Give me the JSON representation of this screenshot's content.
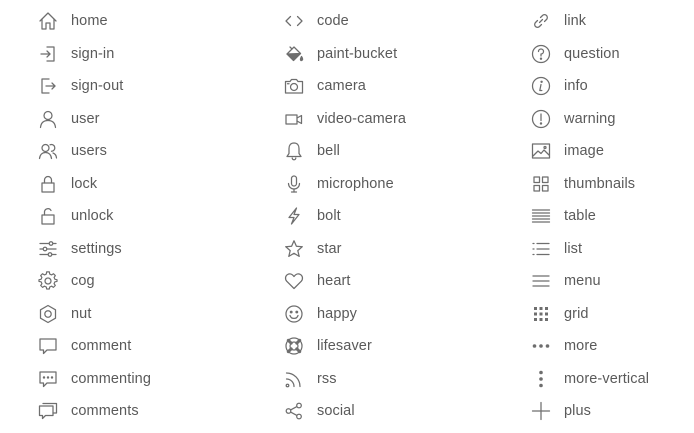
{
  "columns": [
    {
      "items": [
        {
          "icon": "home-icon",
          "label": "home"
        },
        {
          "icon": "sign-in-icon",
          "label": "sign-in"
        },
        {
          "icon": "sign-out-icon",
          "label": "sign-out"
        },
        {
          "icon": "user-icon",
          "label": "user"
        },
        {
          "icon": "users-icon",
          "label": "users"
        },
        {
          "icon": "lock-icon",
          "label": "lock"
        },
        {
          "icon": "unlock-icon",
          "label": "unlock"
        },
        {
          "icon": "settings-icon",
          "label": "settings"
        },
        {
          "icon": "cog-icon",
          "label": "cog"
        },
        {
          "icon": "nut-icon",
          "label": "nut"
        },
        {
          "icon": "comment-icon",
          "label": "comment"
        },
        {
          "icon": "commenting-icon",
          "label": "commenting"
        },
        {
          "icon": "comments-icon",
          "label": "comments"
        }
      ]
    },
    {
      "items": [
        {
          "icon": "code-icon",
          "label": "code"
        },
        {
          "icon": "paint-bucket-icon",
          "label": "paint-bucket"
        },
        {
          "icon": "camera-icon",
          "label": "camera"
        },
        {
          "icon": "video-camera-icon",
          "label": "video-camera"
        },
        {
          "icon": "bell-icon",
          "label": "bell"
        },
        {
          "icon": "microphone-icon",
          "label": "microphone"
        },
        {
          "icon": "bolt-icon",
          "label": "bolt"
        },
        {
          "icon": "star-icon",
          "label": "star"
        },
        {
          "icon": "heart-icon",
          "label": "heart"
        },
        {
          "icon": "happy-icon",
          "label": "happy"
        },
        {
          "icon": "lifesaver-icon",
          "label": "lifesaver"
        },
        {
          "icon": "rss-icon",
          "label": "rss"
        },
        {
          "icon": "social-icon",
          "label": "social"
        }
      ]
    },
    {
      "items": [
        {
          "icon": "link-icon",
          "label": "link"
        },
        {
          "icon": "question-icon",
          "label": "question"
        },
        {
          "icon": "info-icon",
          "label": "info"
        },
        {
          "icon": "warning-icon",
          "label": "warning"
        },
        {
          "icon": "image-icon",
          "label": "image"
        },
        {
          "icon": "thumbnails-icon",
          "label": "thumbnails"
        },
        {
          "icon": "table-icon",
          "label": "table"
        },
        {
          "icon": "list-icon",
          "label": "list"
        },
        {
          "icon": "menu-icon",
          "label": "menu"
        },
        {
          "icon": "grid-icon",
          "label": "grid"
        },
        {
          "icon": "more-icon",
          "label": "more"
        },
        {
          "icon": "more-vertical-icon",
          "label": "more-vertical"
        },
        {
          "icon": "plus-icon",
          "label": "plus"
        }
      ]
    }
  ]
}
